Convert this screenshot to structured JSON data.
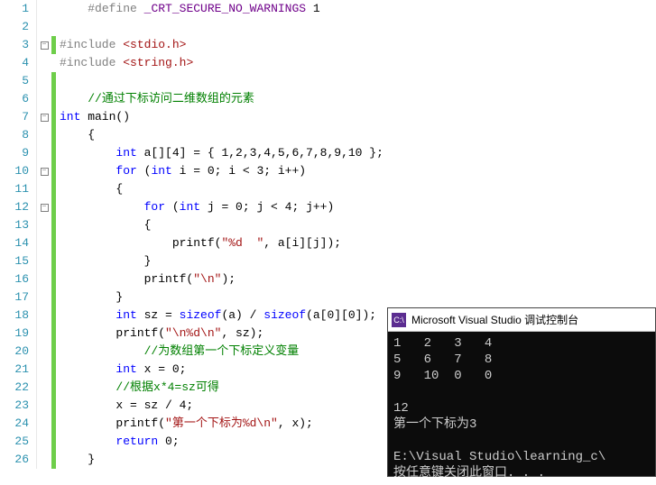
{
  "lines": [
    {
      "n": 1,
      "fold": "",
      "bar": "",
      "tokens": [
        [
          "    ",
          ""
        ],
        [
          "#define",
          "c-pp"
        ],
        [
          " ",
          ""
        ],
        [
          "_CRT_SECURE_NO_WARNINGS",
          "c-def"
        ],
        [
          " 1",
          "c-num"
        ]
      ]
    },
    {
      "n": 2,
      "fold": "",
      "bar": "",
      "tokens": []
    },
    {
      "n": 3,
      "fold": "box",
      "bar": "g",
      "tokens": [
        [
          "#include",
          "c-pp"
        ],
        [
          " ",
          ""
        ],
        [
          "<stdio.h>",
          "c-inc"
        ]
      ]
    },
    {
      "n": 4,
      "fold": "",
      "bar": "",
      "tokens": [
        [
          "#include",
          "c-pp"
        ],
        [
          " ",
          ""
        ],
        [
          "<string.h>",
          "c-inc"
        ]
      ]
    },
    {
      "n": 5,
      "fold": "",
      "bar": "g",
      "tokens": []
    },
    {
      "n": 6,
      "fold": "",
      "bar": "g",
      "tokens": [
        [
          "    ",
          ""
        ],
        [
          "//通过下标访问二维数组的元素",
          "c-cmt"
        ]
      ]
    },
    {
      "n": 7,
      "fold": "box",
      "bar": "g",
      "tokens": [
        [
          "int",
          "c-kw"
        ],
        [
          " main()",
          ""
        ]
      ]
    },
    {
      "n": 8,
      "fold": "",
      "bar": "g",
      "tokens": [
        [
          "    {",
          ""
        ]
      ]
    },
    {
      "n": 9,
      "fold": "",
      "bar": "g",
      "tokens": [
        [
          "        ",
          ""
        ],
        [
          "int",
          "c-kw"
        ],
        [
          " a[][4] = { 1,2,3,4,5,6,7,8,9,10 };",
          ""
        ]
      ]
    },
    {
      "n": 10,
      "fold": "box",
      "bar": "g",
      "tokens": [
        [
          "        ",
          ""
        ],
        [
          "for",
          "c-kw"
        ],
        [
          " (",
          ""
        ],
        [
          "int",
          "c-kw"
        ],
        [
          " i = 0; i < 3; i++)",
          ""
        ]
      ]
    },
    {
      "n": 11,
      "fold": "",
      "bar": "g",
      "tokens": [
        [
          "        {",
          ""
        ]
      ]
    },
    {
      "n": 12,
      "fold": "box",
      "bar": "g",
      "tokens": [
        [
          "            ",
          ""
        ],
        [
          "for",
          "c-kw"
        ],
        [
          " (",
          ""
        ],
        [
          "int",
          "c-kw"
        ],
        [
          " j = 0; j < 4; j++)",
          ""
        ]
      ]
    },
    {
      "n": 13,
      "fold": "",
      "bar": "g",
      "tokens": [
        [
          "            {",
          ""
        ]
      ]
    },
    {
      "n": 14,
      "fold": "",
      "bar": "g",
      "tokens": [
        [
          "                printf(",
          ""
        ],
        [
          "\"%d  \"",
          "c-str"
        ],
        [
          ", a[i][j]);",
          ""
        ]
      ]
    },
    {
      "n": 15,
      "fold": "",
      "bar": "g",
      "tokens": [
        [
          "            }",
          ""
        ]
      ]
    },
    {
      "n": 16,
      "fold": "",
      "bar": "g",
      "tokens": [
        [
          "            printf(",
          ""
        ],
        [
          "\"\\n\"",
          "c-str"
        ],
        [
          ");",
          ""
        ]
      ]
    },
    {
      "n": 17,
      "fold": "",
      "bar": "g",
      "tokens": [
        [
          "        }",
          ""
        ]
      ]
    },
    {
      "n": 18,
      "fold": "",
      "bar": "g",
      "tokens": [
        [
          "        ",
          ""
        ],
        [
          "int",
          "c-kw"
        ],
        [
          " sz = ",
          ""
        ],
        [
          "sizeof",
          "c-kw"
        ],
        [
          "(a) / ",
          ""
        ],
        [
          "sizeof",
          "c-kw"
        ],
        [
          "(a[0][0]);",
          ""
        ]
      ]
    },
    {
      "n": 19,
      "fold": "",
      "bar": "g",
      "tokens": [
        [
          "        printf(",
          ""
        ],
        [
          "\"\\n%d\\n\"",
          "c-str"
        ],
        [
          ", sz);",
          ""
        ]
      ]
    },
    {
      "n": 20,
      "fold": "",
      "bar": "g",
      "tokens": [
        [
          "            ",
          ""
        ],
        [
          "//为数组第一个下标定义变量",
          "c-cmt"
        ]
      ]
    },
    {
      "n": 21,
      "fold": "",
      "bar": "g",
      "tokens": [
        [
          "        ",
          ""
        ],
        [
          "int",
          "c-kw"
        ],
        [
          " x = 0;",
          ""
        ]
      ]
    },
    {
      "n": 22,
      "fold": "",
      "bar": "g",
      "tokens": [
        [
          "        ",
          ""
        ],
        [
          "//根据x*4=sz可得",
          "c-cmt"
        ]
      ]
    },
    {
      "n": 23,
      "fold": "",
      "bar": "g",
      "tokens": [
        [
          "        x = sz / 4;",
          ""
        ]
      ]
    },
    {
      "n": 24,
      "fold": "",
      "bar": "g",
      "tokens": [
        [
          "        printf(",
          ""
        ],
        [
          "\"第一个下标为%d\\n\"",
          "c-str"
        ],
        [
          ", x);",
          ""
        ]
      ]
    },
    {
      "n": 25,
      "fold": "",
      "bar": "g",
      "tokens": [
        [
          "        ",
          ""
        ],
        [
          "return",
          "c-kw"
        ],
        [
          " 0;",
          ""
        ]
      ]
    },
    {
      "n": 26,
      "fold": "",
      "bar": "g",
      "tokens": [
        [
          "    }",
          ""
        ]
      ]
    }
  ],
  "console": {
    "icon": "C:\\",
    "title": "Microsoft Visual Studio 调试控制台",
    "out": "1   2   3   4\n5   6   7   8\n9   10  0   0\n\n12\n第一个下标为3\n\nE:\\Visual Studio\\learning_c\\\n按任意键关闭此窗口. . ."
  }
}
